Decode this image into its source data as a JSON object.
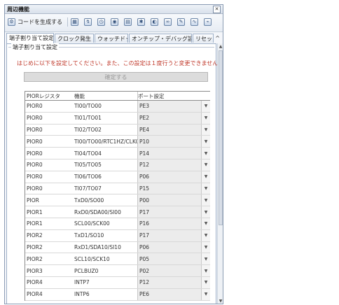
{
  "window": {
    "title": "周辺機能",
    "close_glyph": "✕"
  },
  "toolbar": {
    "generate_label": "コードを生成する",
    "icons": [
      "generate-icon",
      "pin-icon",
      "icon-3",
      "icon-4",
      "icon-5",
      "icon-6",
      "icon-7",
      "icon-8",
      "icon-9",
      "icon-10",
      "icon-11"
    ]
  },
  "tabs": {
    "items": [
      "端子割り当て設定",
      "クロック発生",
      "ウォッチドッグ",
      "オンチップ・デバッグ設定",
      "リセット"
    ],
    "scroll_glyph": "^"
  },
  "group": {
    "title": "端子割り当て設定"
  },
  "notice": "はじめに以下を設定してください。また、この設定は１度行うと変更できません。",
  "apply_button": "確定する",
  "table": {
    "headers": [
      "PIORレジスタ",
      "機能",
      "ポート設定"
    ],
    "rows": [
      [
        "PIOR0",
        "TI00/TO00",
        "PE3"
      ],
      [
        "PIOR0",
        "TI01/TO01",
        "PE2"
      ],
      [
        "PIOR0",
        "TI02/TO02",
        "PE4"
      ],
      [
        "PIOR0",
        "TI00/TO00/RTC1HZ/CLKOUT",
        "P10"
      ],
      [
        "PIOR0",
        "TI04/TO04",
        "P14"
      ],
      [
        "PIOR0",
        "TI05/TO05",
        "P12"
      ],
      [
        "PIOR0",
        "TI06/TO06",
        "P06"
      ],
      [
        "PIOR0",
        "TI07/TO07",
        "P15"
      ],
      [
        "PIOR",
        "TxD0/SO00",
        "P00"
      ],
      [
        "PIOR1",
        "RxD0/SDA00/SI00",
        "P17"
      ],
      [
        "PIOR1",
        "SCL00/SCK00",
        "P16"
      ],
      [
        "PIOR2",
        "TxD1/SO10",
        "P17"
      ],
      [
        "PIOR2",
        "RxD1/SDA10/SI10",
        "P06"
      ],
      [
        "PIOR2",
        "SCL10/SCK10",
        "P05"
      ],
      [
        "PIOR3",
        "PCLBUZ0",
        "P02"
      ],
      [
        "PIOR4",
        "INTP7",
        "P12"
      ],
      [
        "PIOR4",
        "INTP6",
        "PE6"
      ]
    ]
  },
  "scrollbar": {
    "up_glyph": "▲",
    "down_glyph": "▼"
  }
}
